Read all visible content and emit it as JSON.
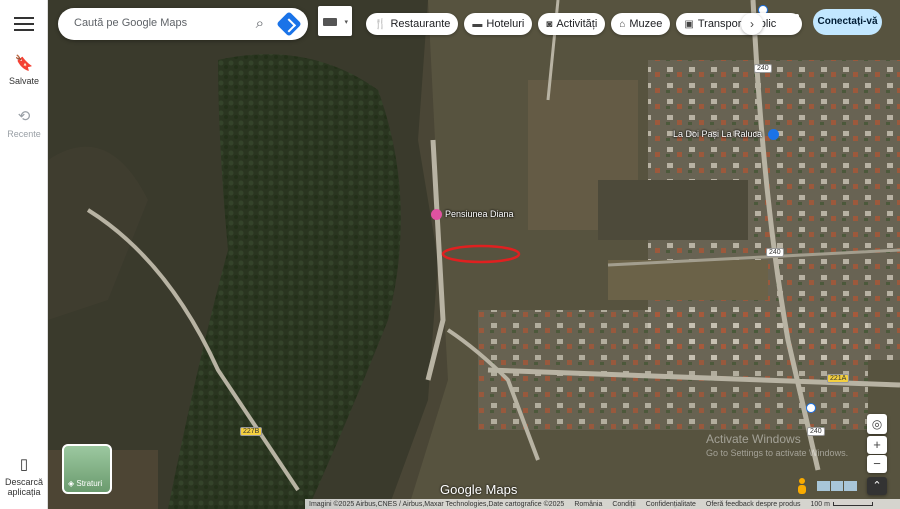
{
  "rail": {
    "saved_label": "Salvate",
    "recent_label": "Recente",
    "download_label_1": "Descarcă",
    "download_label_2": "aplicația"
  },
  "search": {
    "placeholder": "Caută pe Google Maps"
  },
  "chips": [
    {
      "label": "Restaurante",
      "icon": "restaurant-icon"
    },
    {
      "label": "Hoteluri",
      "icon": "hotel-icon"
    },
    {
      "label": "Activități",
      "icon": "camera-icon"
    },
    {
      "label": "Muzee",
      "icon": "museum-icon"
    },
    {
      "label": "Transport public",
      "icon": "transit-icon"
    }
  ],
  "signin_label": "Conectați-vă",
  "map": {
    "poi_1": "La Doi Pași La Raluca",
    "poi_2": "Pensiunea Diana",
    "road_240": "240",
    "road_221a": "221A",
    "road_227": "227B",
    "layers_label": "Straturi",
    "watermark_1": "Activate Windows",
    "watermark_2": "Go to Settings to activate Windows.",
    "logo": "Google Maps",
    "highlight_color": "#e02020"
  },
  "footer": {
    "imagery": "Imagini ©2025 Airbus,CNES / Airbus,Maxar Technologies,Date cartografice ©2025",
    "country": "România",
    "terms": "Condiții",
    "privacy": "Confidențialitate",
    "feedback": "Oferă feedback despre produs",
    "scale": "100 m"
  }
}
